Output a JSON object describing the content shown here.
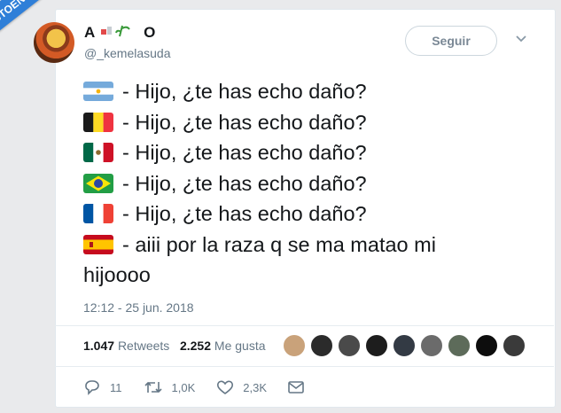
{
  "watermark": "VISTOENLASREDES.com",
  "user": {
    "name_initial": "A",
    "name_final": "O",
    "handle": "@_kemelasuda"
  },
  "follow_button": "Seguir",
  "tweet": {
    "lines": [
      {
        "flag": "argentina",
        "text": "- Hijo, ¿te has echo daño?"
      },
      {
        "flag": "belgium",
        "text": "- Hijo, ¿te has echo daño?"
      },
      {
        "flag": "mexico",
        "text": "- Hijo, ¿te has echo daño?"
      },
      {
        "flag": "brazil",
        "text": "- Hijo, ¿te has echo daño?"
      },
      {
        "flag": "france",
        "text": "- Hijo, ¿te has echo daño?"
      },
      {
        "flag": "spain",
        "text": "- aiii por la raza q se ma matao mi"
      }
    ],
    "continuation": "hijoooo"
  },
  "timestamp": "12:12 - 25 jun. 2018",
  "stats": {
    "retweets_count": "1.047",
    "retweets_label": "Retweets",
    "likes_count": "2.252",
    "likes_label": "Me gusta"
  },
  "liker_colors": [
    "#c9a27a",
    "#2b2b2b",
    "#4a4a4a",
    "#1d1d1d",
    "#333a44",
    "#6b6b6b",
    "#5d6b5a",
    "#0d0d0d",
    "#3a3a3a"
  ],
  "actions": {
    "replies": "11",
    "retweets": "1,0K",
    "likes": "2,3K"
  },
  "colors": {
    "text": "#14171a",
    "secondary": "#657786",
    "watermark": "#2f7fd8"
  }
}
